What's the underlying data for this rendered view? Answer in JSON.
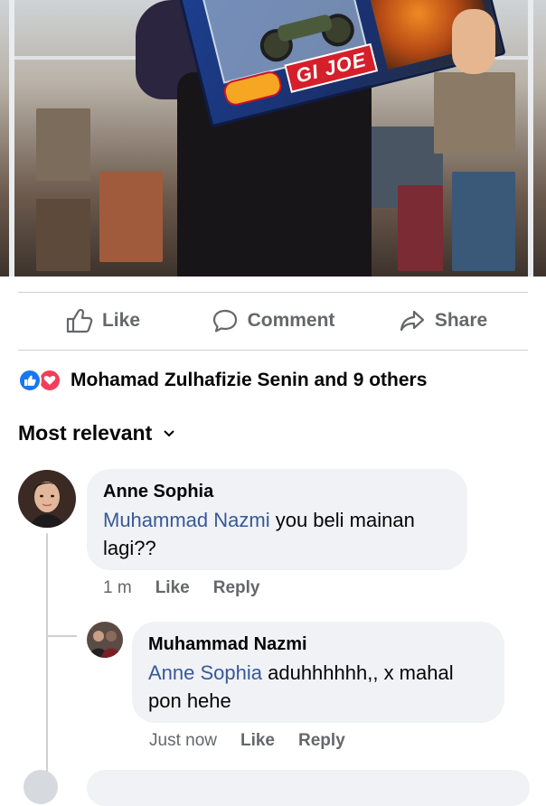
{
  "photo": {
    "product_logo": "GI JOE"
  },
  "actions": {
    "like": "Like",
    "comment": "Comment",
    "share": "Share"
  },
  "reactions": {
    "summary": "Mohamad Zulhafizie Senin and 9 others",
    "icons": [
      "like-reaction",
      "love-reaction"
    ],
    "colors": {
      "like": "#1877f2",
      "love": "#f33e58"
    }
  },
  "sort": {
    "label": "Most relevant"
  },
  "comments": [
    {
      "author": "Anne Sophia",
      "mention": "Muhammad Nazmi",
      "text_line1": " you beli mainan",
      "text_line2": "lagi??",
      "time": "1 m",
      "like_label": "Like",
      "reply_label": "Reply"
    },
    {
      "author": "Muhammad Nazmi",
      "mention": "Anne Sophia",
      "text_line1": " aduhhhhhh,, x mahal",
      "text_line2": "pon hehe",
      "time": "Just now",
      "like_label": "Like",
      "reply_label": "Reply"
    }
  ],
  "colors": {
    "mention": "#385898",
    "secondary_text": "#65676b",
    "bubble": "#f0f2f5"
  }
}
